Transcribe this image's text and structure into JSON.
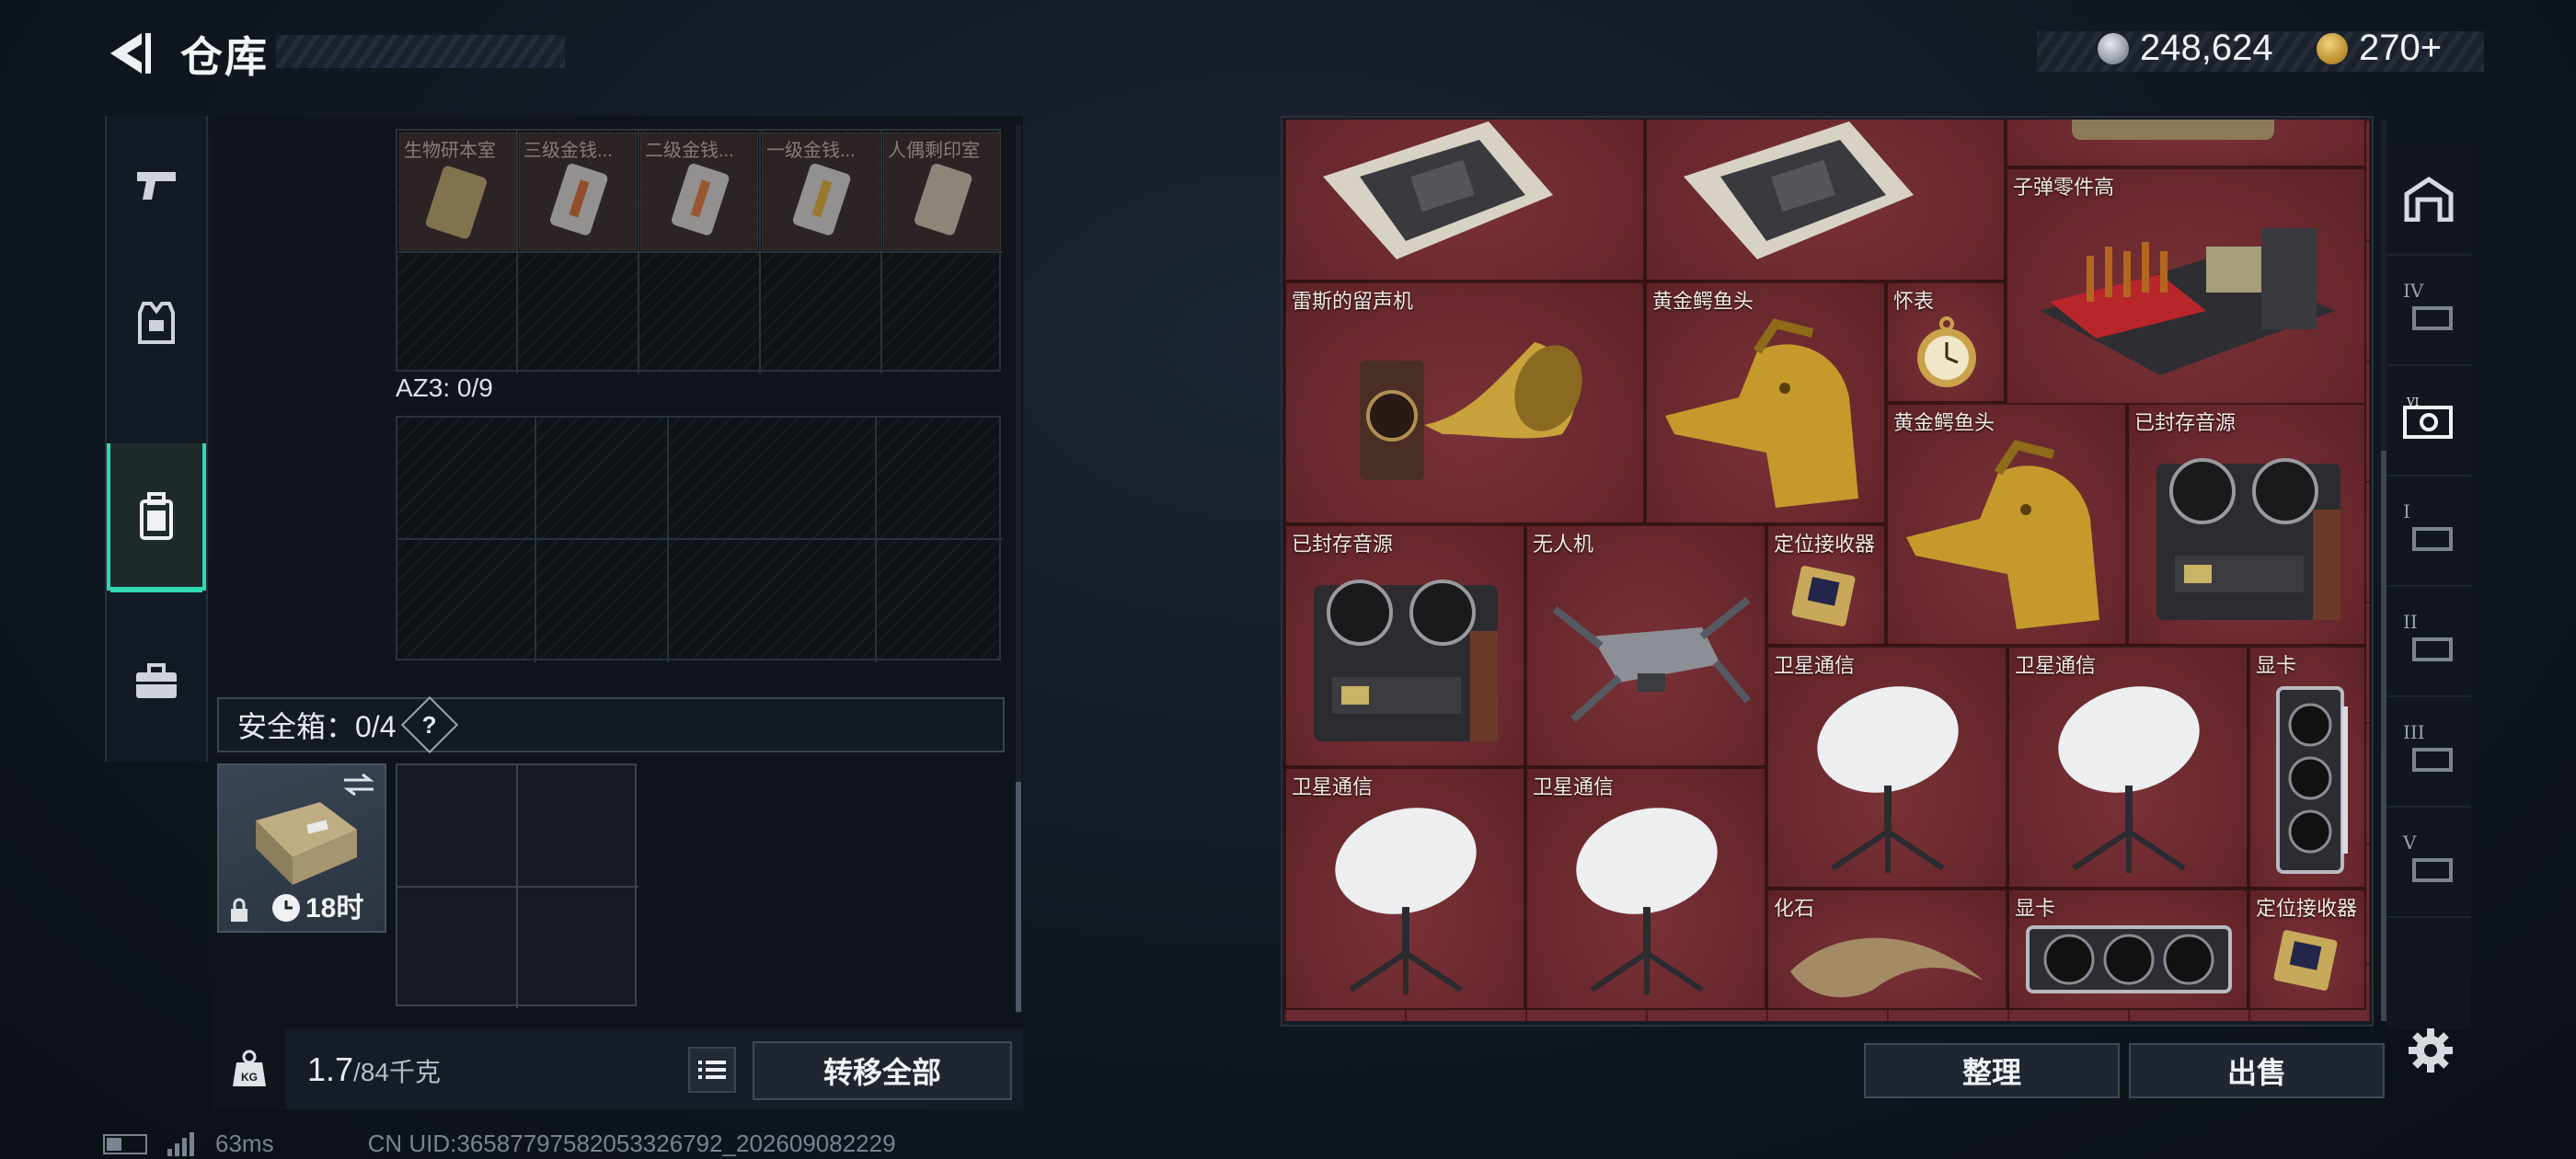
{
  "header": {
    "title": "仓库",
    "currencies": [
      {
        "icon": "silver-coin-icon",
        "value": "248,624"
      },
      {
        "icon": "gold-coin-icon",
        "value": "270+"
      }
    ]
  },
  "left_nav": {
    "items": [
      {
        "icon": "pistol-icon",
        "active": false
      },
      {
        "icon": "vest-icon",
        "active": false
      },
      {
        "icon": "backpack-icon",
        "active": true
      },
      {
        "icon": "briefcase-icon",
        "active": false
      }
    ]
  },
  "backpack": {
    "top_slots": [
      "生物研本室",
      "三级金钱...",
      "二级金钱...",
      "一级金钱...",
      "人偶剩印室"
    ],
    "az3_label": "AZ3: 0/9",
    "safe_box": {
      "label": "安全箱：0/4",
      "help": "?",
      "timer": "18时"
    }
  },
  "footer_left": {
    "weight_current": "1.7",
    "weight_max": "/84千克",
    "transfer_all": "转移全部"
  },
  "stash": {
    "items": [
      {
        "name": "",
        "icon": "gpu-board-icon"
      },
      {
        "name": "",
        "icon": "gpu-board-icon"
      },
      {
        "name": "子弹零件高",
        "icon": "ammo-crate-icon"
      },
      {
        "name": "雷斯的留声机",
        "icon": "gramophone-icon"
      },
      {
        "name": "黄金鳄鱼头",
        "icon": "golden-croc-icon"
      },
      {
        "name": "怀表",
        "icon": "pocket-watch-icon"
      },
      {
        "name": "黄金鳄鱼头",
        "icon": "golden-croc-icon"
      },
      {
        "name": "已封存音源",
        "icon": "reel-recorder-icon"
      },
      {
        "name": "已封存音源",
        "icon": "reel-recorder-icon"
      },
      {
        "name": "无人机",
        "icon": "drone-icon"
      },
      {
        "name": "定位接收器",
        "icon": "locator-icon"
      },
      {
        "name": "卫星通信",
        "icon": "satellite-dish-icon"
      },
      {
        "name": "卫星通信",
        "icon": "satellite-dish-icon"
      },
      {
        "name": "显卡",
        "icon": "graphics-card-icon"
      },
      {
        "name": "卫星通信",
        "icon": "satellite-dish-icon"
      },
      {
        "name": "卫星通信",
        "icon": "satellite-dish-icon"
      },
      {
        "name": "化石",
        "icon": "fossil-claw-icon"
      },
      {
        "name": "显卡",
        "icon": "graphics-card-icon"
      },
      {
        "name": "定位接收器",
        "icon": "locator-icon"
      }
    ],
    "sort_label": "整理",
    "sell_label": "出售"
  },
  "right_nav": {
    "items": [
      {
        "roman": "",
        "icon": "vault-icon"
      },
      {
        "roman": "IV",
        "icon": "stash-tab-icon"
      },
      {
        "roman": "",
        "icon": "stash-tab-icon",
        "active": true
      },
      {
        "roman": "I",
        "icon": "stash-tab-icon"
      },
      {
        "roman": "II",
        "icon": "stash-tab-icon"
      },
      {
        "roman": "III",
        "icon": "stash-tab-icon"
      },
      {
        "roman": "V",
        "icon": "stash-tab-icon"
      }
    ]
  },
  "status": {
    "ping": "63ms",
    "uid": "CN UID:3658779758205332679​2_202609082229"
  }
}
